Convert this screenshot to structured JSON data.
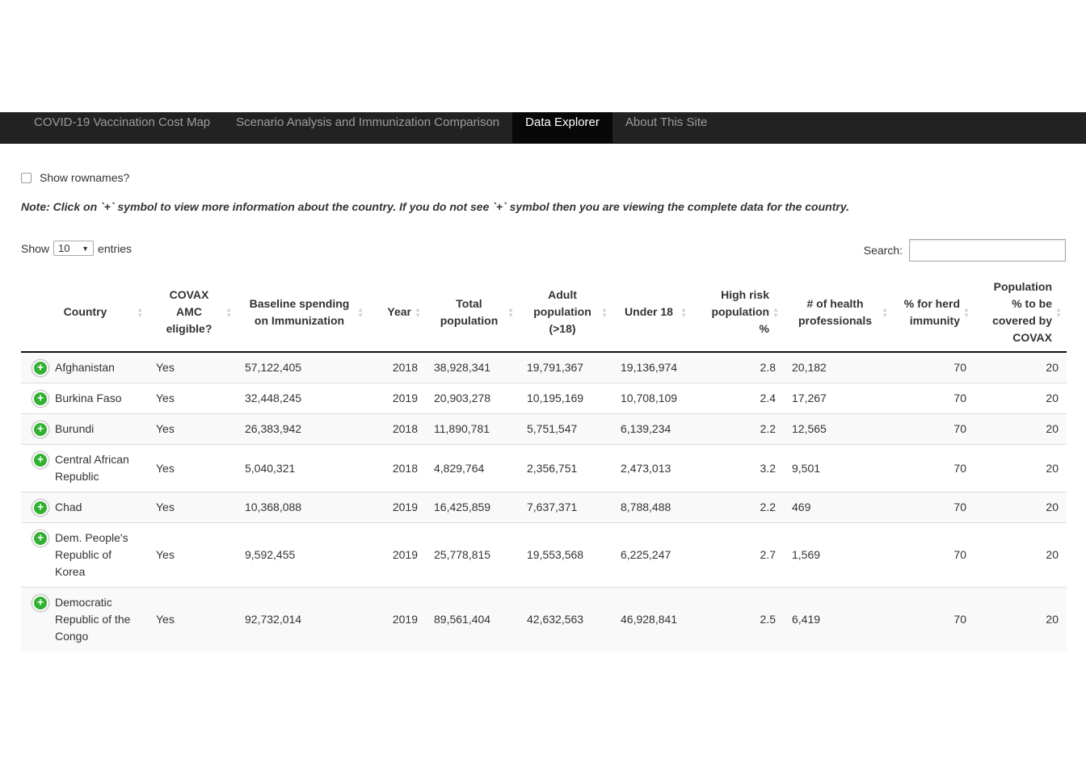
{
  "nav": {
    "tabs": [
      {
        "label": "COVID-19 Vaccination Cost Map",
        "active": false
      },
      {
        "label": "Scenario Analysis and Immunization Comparison",
        "active": false
      },
      {
        "label": "Data Explorer",
        "active": true
      },
      {
        "label": "About This Site",
        "active": false
      }
    ]
  },
  "controls": {
    "show_rownames_label": "Show rownames?",
    "show_rownames_checked": false,
    "note": "Note: Click on `+` symbol to view more information about the country. If you do not see `+` symbol then you are viewing the complete data for the country.",
    "length_prefix": "Show",
    "length_value": "10",
    "length_suffix": "entries",
    "search_label": "Search:",
    "search_value": ""
  },
  "table": {
    "headers": [
      "Country",
      "COVAX AMC eligible?",
      "Baseline spending on Immunization",
      "Year",
      "Total population",
      "Adult population (>18)",
      "Under 18",
      "High risk population %",
      "# of health professionals",
      "% for herd immunity",
      "Population % to be covered by COVAX"
    ],
    "rows": [
      [
        "Afghanistan",
        "Yes",
        "57,122,405",
        "2018",
        "38,928,341",
        "19,791,367",
        "19,136,974",
        "2.8",
        "20,182",
        "70",
        "20"
      ],
      [
        "Burkina Faso",
        "Yes",
        "32,448,245",
        "2019",
        "20,903,278",
        "10,195,169",
        "10,708,109",
        "2.4",
        "17,267",
        "70",
        "20"
      ],
      [
        "Burundi",
        "Yes",
        "26,383,942",
        "2018",
        "11,890,781",
        "5,751,547",
        "6,139,234",
        "2.2",
        "12,565",
        "70",
        "20"
      ],
      [
        "Central African Republic",
        "Yes",
        "5,040,321",
        "2018",
        "4,829,764",
        "2,356,751",
        "2,473,013",
        "3.2",
        "9,501",
        "70",
        "20"
      ],
      [
        "Chad",
        "Yes",
        "10,368,088",
        "2019",
        "16,425,859",
        "7,637,371",
        "8,788,488",
        "2.2",
        "469",
        "70",
        "20"
      ],
      [
        "Dem. People's Republic of Korea",
        "Yes",
        "9,592,455",
        "2019",
        "25,778,815",
        "19,553,568",
        "6,225,247",
        "2.7",
        "1,569",
        "70",
        "20"
      ],
      [
        "Democratic Republic of the Congo",
        "Yes",
        "92,732,014",
        "2019",
        "89,561,404",
        "42,632,563",
        "46,928,841",
        "2.5",
        "6,419",
        "70",
        "20"
      ]
    ]
  },
  "colors": {
    "navbar_bg": "#222222",
    "navbar_active_bg": "#080808",
    "expand_icon": "#31b131"
  },
  "icons": {
    "expand": "plus-circle-icon",
    "sort": "sort-both-icon"
  }
}
